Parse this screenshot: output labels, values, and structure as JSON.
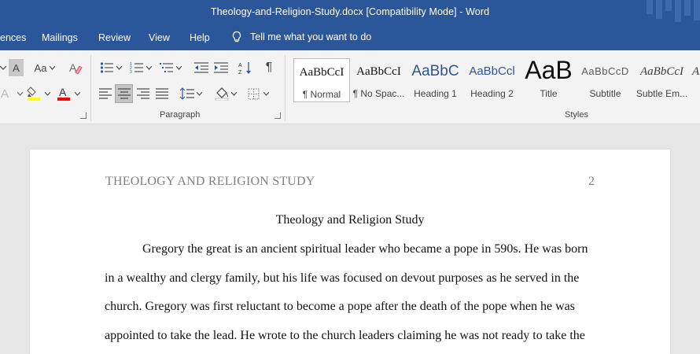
{
  "titlebar": {
    "title": "Theology-and-Religion-Study.docx [Compatibility Mode]  -  Word"
  },
  "menu": {
    "items": [
      "ences",
      "Mailings",
      "Review",
      "View",
      "Help"
    ],
    "tell_me": "Tell me what you want to do"
  },
  "ribbon": {
    "font_fragment": {
      "aa_label": "Aa",
      "small_a": "A"
    },
    "paragraph_label": "Paragraph",
    "styles_label": "Styles",
    "styles": [
      {
        "preview": "AaBbCcI",
        "name": "¶ Normal"
      },
      {
        "preview": "AaBbCcI",
        "name": "¶ No Spac..."
      },
      {
        "preview": "AaBbC",
        "name": "Heading 1"
      },
      {
        "preview": "AaBbCcl",
        "name": "Heading 2"
      },
      {
        "preview": "AaB",
        "name": "Title"
      },
      {
        "preview": "AaBbCcD",
        "name": "Subtitle"
      },
      {
        "preview": "AaBbCcI",
        "name": "Subtle Em..."
      },
      {
        "preview": "A",
        "name": ""
      }
    ],
    "colors": {
      "highlight": "#ffff00",
      "font_color": "#ff0000",
      "accent": "#2b579a"
    }
  },
  "document": {
    "running_header": "THEOLOGY AND RELIGION STUDY",
    "page_number": "2",
    "title": "Theology and Religion Study",
    "lines": [
      "Gregory the great is an ancient spiritual leader who became a pope in 590s. He was born",
      "in a wealthy and clergy family, but his life was focused on devout purposes as he served in the",
      "church. Gregory was first reluctant to become a pope after the death of the pope when he was",
      "appointed to take the lead. He wrote to the church leaders claiming he was not ready to take the"
    ]
  }
}
